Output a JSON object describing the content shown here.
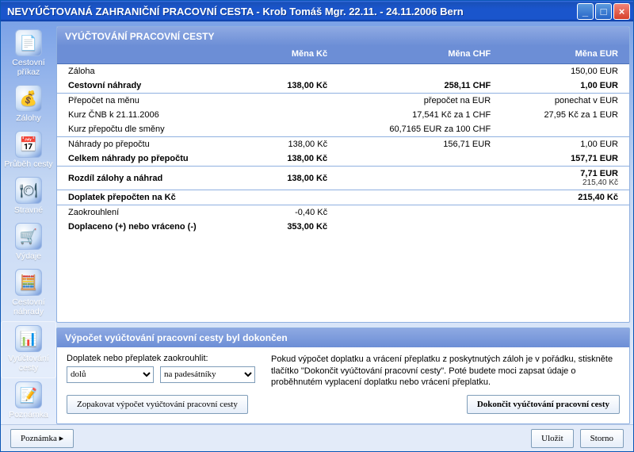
{
  "titlebar": {
    "title": "NEVYÚČTOVANÁ ZAHRANIČNÍ PRACOVNÍ CESTA - Krob Tomáš Mgr. 22.11. - 24.11.2006  Bern"
  },
  "sidebar": {
    "items": [
      {
        "label": "Cestovní příkaz",
        "icon": "📄"
      },
      {
        "label": "Zálohy",
        "icon": "💰"
      },
      {
        "label": "Průběh cesty",
        "icon": "📅"
      },
      {
        "label": "Stravné",
        "icon": "🍽"
      },
      {
        "label": "Výdaje",
        "icon": "🛒"
      },
      {
        "label": "Cestovní náhrady",
        "icon": "🧮"
      },
      {
        "label": "Vyúčtování cesty",
        "icon": "📊",
        "selected": true
      },
      {
        "label": "Poznámka",
        "icon": "📝"
      }
    ]
  },
  "topPanel": {
    "heading": "VYÚČTOVÁNÍ PRACOVNÍ CESTY",
    "headers": {
      "c0": "",
      "c1": "Měna Kč",
      "c2": "Měna CHF",
      "c3": "Měna EUR"
    },
    "rows": [
      {
        "label": "Záloha",
        "kc": "",
        "chf": "",
        "eur": "150,00 EUR",
        "sep": false,
        "bold": false
      },
      {
        "label": "Cestovní náhrady",
        "kc": "138,00 Kč",
        "chf": "258,11 CHF",
        "eur": "1,00 EUR",
        "sep": false,
        "bold": true
      },
      {
        "label": "Přepočet na měnu",
        "kc": "",
        "chf": "přepočet na EUR",
        "eur": "ponechat v EUR",
        "sep": true,
        "bold": false
      },
      {
        "label": "Kurz ČNB k 21.11.2006",
        "kc": "",
        "chf": "17,541 Kč za 1 CHF",
        "eur": "27,95 Kč za 1 EUR",
        "sep": false,
        "bold": false
      },
      {
        "label": "Kurz přepočtu dle směny",
        "kc": "",
        "chf": "60,7165 EUR za 100 CHF",
        "eur": "",
        "sep": false,
        "bold": false
      },
      {
        "label": "Náhrady po přepočtu",
        "kc": "138,00 Kč",
        "chf": "156,71 EUR",
        "eur": "1,00 EUR",
        "sep": true,
        "bold": false
      },
      {
        "label": "Celkem náhrady po přepočtu",
        "kc": "138,00 Kč",
        "chf": "",
        "eur": "157,71 EUR",
        "sep": false,
        "bold": true
      },
      {
        "label": "Rozdíl zálohy a náhrad",
        "kc": "138,00 Kč",
        "chf": "",
        "eur": "7,71 EUR",
        "eur_sub": "215,40 Kč",
        "sep": true,
        "bold": true
      },
      {
        "label": "Doplatek přepočten na Kč",
        "kc": "",
        "chf": "",
        "eur": "215,40 Kč",
        "sep": true,
        "bold": true
      },
      {
        "label": "Zaokrouhlení",
        "kc": "-0,40 Kč",
        "chf": "",
        "eur": "",
        "sep": true,
        "bold": false
      },
      {
        "label": "Doplaceno (+) nebo vráceno (-)",
        "kc": "353,00 Kč",
        "chf": "",
        "eur": "",
        "sep": false,
        "bold": true
      }
    ]
  },
  "bottomPanel": {
    "heading": "Výpočet vyúčtování pracovní cesty byl dokončen",
    "roundLabel": "Doplatek nebo přeplatek zaokrouhlit:",
    "select1": {
      "value": "dolů"
    },
    "select2": {
      "value": "na padesátníky"
    },
    "info": "Pokud výpočet doplatku a vrácení přeplatku z poskytnutých záloh je v pořádku, stiskněte tlačítko \"Dokončit vyúčtování pracovní cesty\". Poté budete moci zapsat údaje o proběhnutém vyplacení doplatku nebo vrácení přeplatku.",
    "btnRepeat": "Zopakovat výpočet vyúčtování pracovní cesty",
    "btnFinish": "Dokončit vyúčtování pracovní cesty"
  },
  "footer": {
    "note": "Poznámka",
    "save": "Uložit",
    "cancel": "Storno"
  }
}
